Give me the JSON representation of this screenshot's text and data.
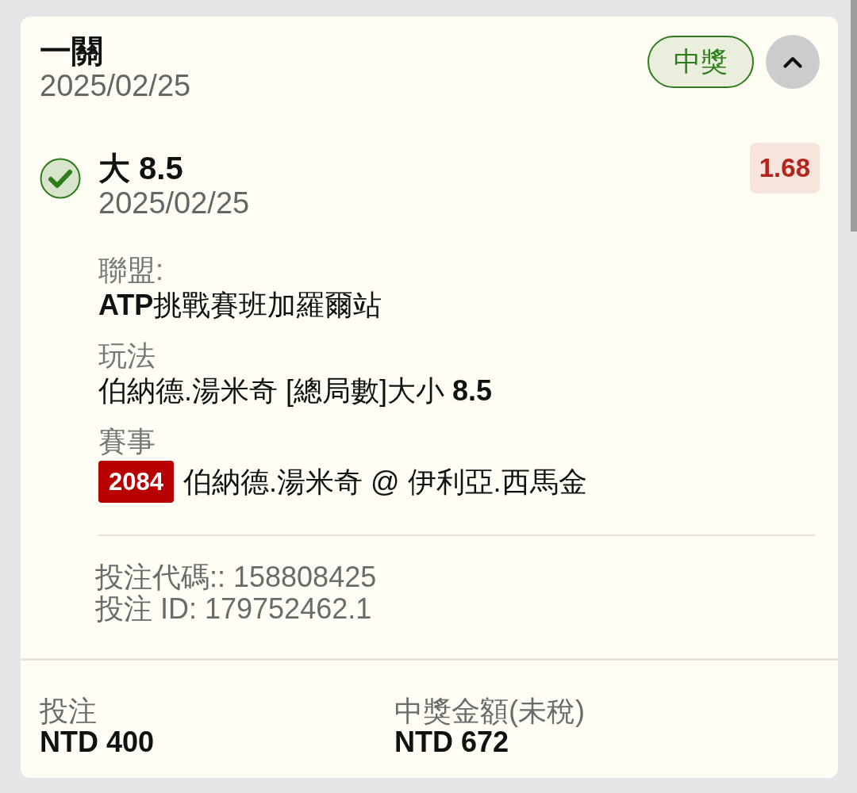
{
  "header": {
    "title": "一關",
    "date": "2025/02/25",
    "status_badge": {
      "label": "中獎",
      "won": true
    },
    "collapse_button": {
      "expanded": true
    }
  },
  "selection": {
    "won": true,
    "title": "大 8.5",
    "date": "2025/02/25",
    "odds": "1.68"
  },
  "details": [
    {
      "label": "聯盟:",
      "value": "**ATP**挑戰賽班加羅爾站"
    },
    {
      "label": "玩法",
      "value": "伯納德.湯米奇 [總局數]大小 **8.5**"
    },
    {
      "label": "賽事",
      "event_number": "2084",
      "value": "伯納德.湯米奇 @ 伊利亞.西馬金"
    }
  ],
  "references": [
    "投注代碼:: 158808425",
    "投注 ID: 179752462.1"
  ],
  "summary": [
    {
      "label": "投注",
      "value": "NTD 400"
    },
    {
      "label": "中獎金額(未稅)",
      "value": "NTD 672"
    }
  ]
}
